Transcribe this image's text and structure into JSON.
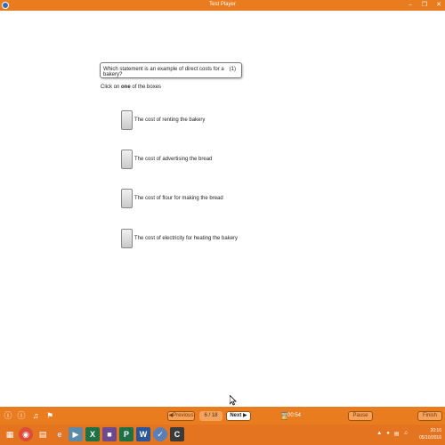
{
  "window": {
    "title": "Test Player"
  },
  "question": {
    "text": "Which statement is an example of direct costs for a bakery?",
    "marks": "(1)",
    "instruction_before": "Click on ",
    "instruction_bold": "one",
    "instruction_after": " of the boxes"
  },
  "options": [
    {
      "label": "The cost of renting the bakery"
    },
    {
      "label": "The cost of advertising the bread"
    },
    {
      "label": "The cost of flour for making the bread"
    },
    {
      "label": "The cost of electricity for heating the bakery"
    }
  ],
  "navigation": {
    "previous_label": "Previous",
    "page": "6 / 18",
    "next_label": "Next",
    "timer": "00:54",
    "pause_label": "Pause",
    "finish_label": "Finish"
  },
  "taskbar": {
    "clock_time": "20:16",
    "clock_date": "05/10/2016"
  },
  "colors": {
    "accent": "#e87c1f",
    "button_fill": "#f5a25b",
    "taskbar": "#e57420"
  }
}
